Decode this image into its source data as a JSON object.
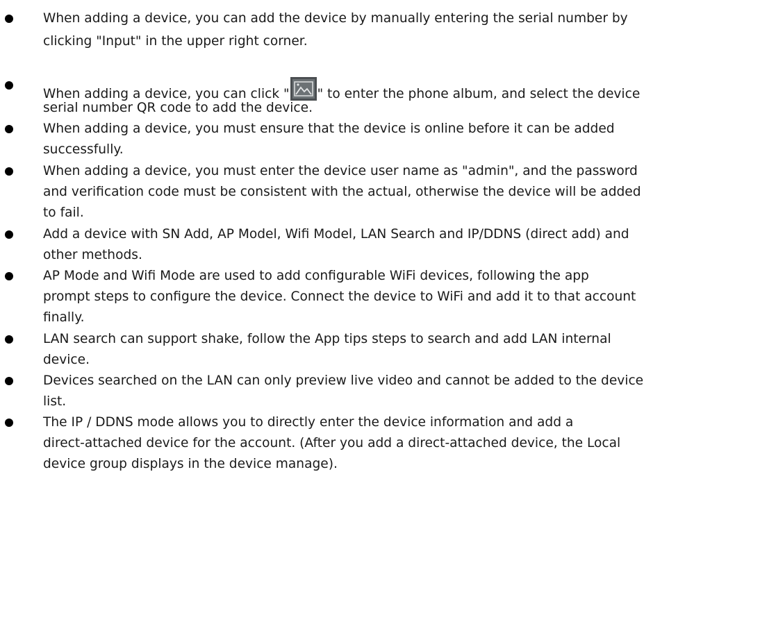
{
  "bullets": [
    {
      "lines": [
        "When adding a device, you can add the device by manually entering the serial number by",
        "clicking \"Input\" in the upper right corner."
      ]
    },
    {
      "line1_before_icon": "When adding a device, you can click \"",
      "line1_after_icon": "\" to enter the phone album, and select the device",
      "icon": "photo-album-icon",
      "line2": "serial number QR code to add the device."
    },
    {
      "lines": [
        "When adding a device, you must ensure that the device is online before it can be added",
        "successfully."
      ]
    },
    {
      "lines": [
        "When adding a device, you must enter the device user name as \"admin\", and the password",
        "and verification code must be consistent with the actual, otherwise the device will be added",
        "to fail."
      ]
    },
    {
      "lines": [
        "Add a device with SN Add, AP Model, Wifi Model, LAN Search and IP/DDNS (direct add) and",
        "other methods."
      ]
    },
    {
      "lines": [
        "AP Mode and Wifi Mode are used to add configurable WiFi devices, following the app",
        "prompt steps to configure the device. Connect the device to WiFi and add it to that account",
        "finally."
      ]
    },
    {
      "lines": [
        "LAN search can support shake, follow the App tips steps to search and add LAN internal",
        "device."
      ]
    },
    {
      "lines": [
        "Devices searched on the LAN can only preview live video and cannot be added to the device",
        "list."
      ]
    },
    {
      "lines": [
        "The IP / DDNS mode allows you to directly enter the device information and add a",
        "direct-attached device for the account. (After you add a direct-attached device, the Local",
        "device group displays in the device manage)."
      ]
    }
  ]
}
